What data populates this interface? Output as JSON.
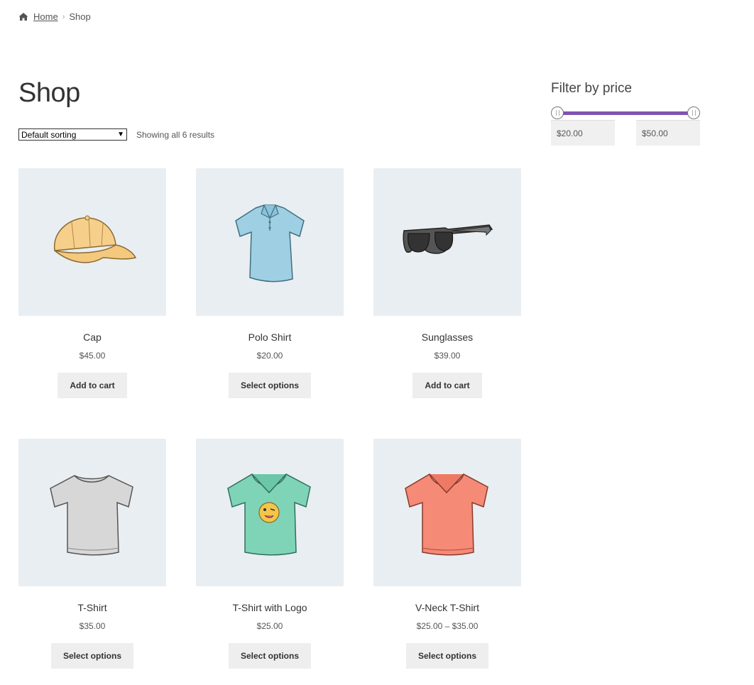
{
  "breadcrumb": {
    "home": "Home",
    "separator": "›",
    "current": "Shop"
  },
  "page_title": "Shop",
  "toolbar": {
    "sort_selected": "Default sorting",
    "result_count": "Showing all 6 results"
  },
  "products": [
    {
      "name": "Cap",
      "price": "$45.00",
      "button": "Add to cart",
      "image": "cap"
    },
    {
      "name": "Polo Shirt",
      "price": "$20.00",
      "button": "Select options",
      "image": "polo-shirt"
    },
    {
      "name": "Sunglasses",
      "price": "$39.00",
      "button": "Add to cart",
      "image": "sunglasses"
    },
    {
      "name": "T-Shirt",
      "price": "$35.00",
      "button": "Select options",
      "image": "t-shirt"
    },
    {
      "name": "T-Shirt with Logo",
      "price": "$25.00",
      "button": "Select options",
      "image": "t-shirt-with-logo"
    },
    {
      "name": "V-Neck T-Shirt",
      "price": "$25.00 – $35.00",
      "button": "Select options",
      "image": "v-neck-t-shirt"
    }
  ],
  "filter": {
    "title": "Filter by price",
    "min_value": "$20.00",
    "max_value": "$50.00"
  },
  "colors": {
    "accent": "#7f54b3",
    "thumb_bg": "#e9eef2",
    "button_bg": "#eeeeee"
  }
}
